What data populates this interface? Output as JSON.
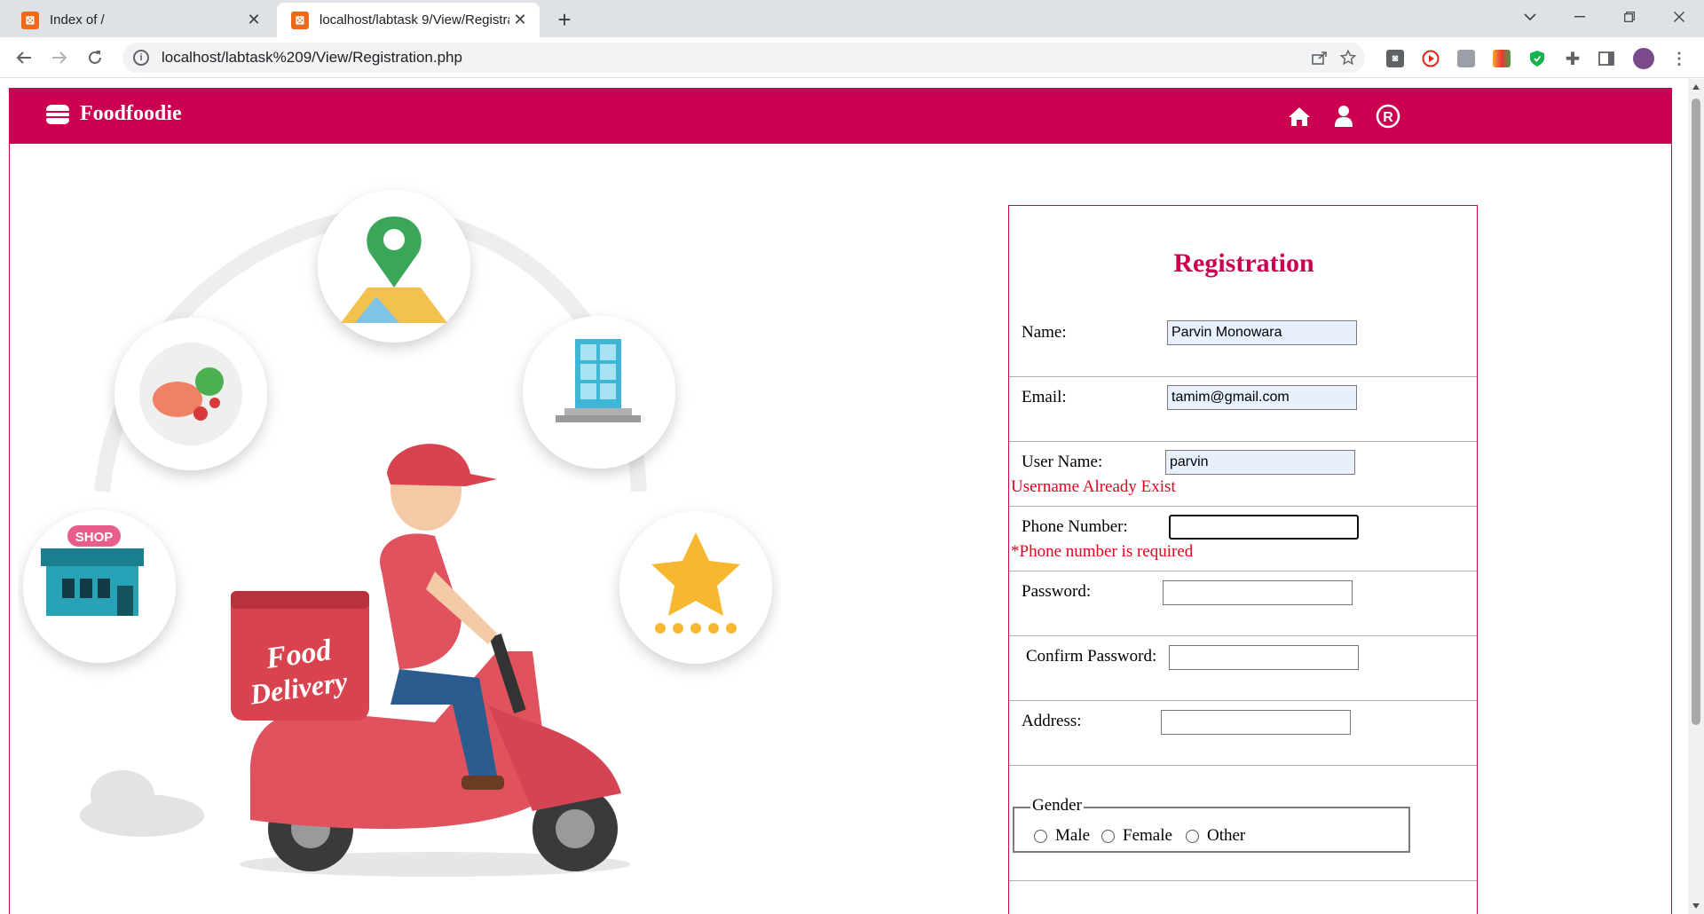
{
  "browser": {
    "tabs": [
      {
        "title": "Index of /",
        "active": false
      },
      {
        "title": "localhost/labtask 9/View/Registra",
        "active": true
      }
    ],
    "url": "localhost/labtask%209/View/Registration.php"
  },
  "site": {
    "brand": "Foodfoodie",
    "brand_color": "#cc0051",
    "nav_icons": [
      "home-icon",
      "user-icon",
      "registered-icon"
    ]
  },
  "illustration": {
    "shop_sign": "SHOP",
    "box_text_1": "Food",
    "box_text_2": "Delivery"
  },
  "form": {
    "title": "Registration",
    "name": {
      "label": "Name:",
      "value": "Parvin Monowara"
    },
    "email": {
      "label": "Email:",
      "value": "tamim@gmail.com"
    },
    "username": {
      "label": "User Name:",
      "value": "parvin",
      "error": "Username Already Exist"
    },
    "phone": {
      "label": "Phone Number:",
      "value": "",
      "error": "*Phone number is required"
    },
    "password": {
      "label": "Password:",
      "value": ""
    },
    "confirm_password": {
      "label": "Confirm Password:",
      "value": ""
    },
    "address": {
      "label": "Address:",
      "value": ""
    },
    "gender": {
      "legend": "Gender",
      "options": [
        "Male",
        "Female",
        "Other"
      ]
    },
    "error_color": "#e8001c"
  }
}
